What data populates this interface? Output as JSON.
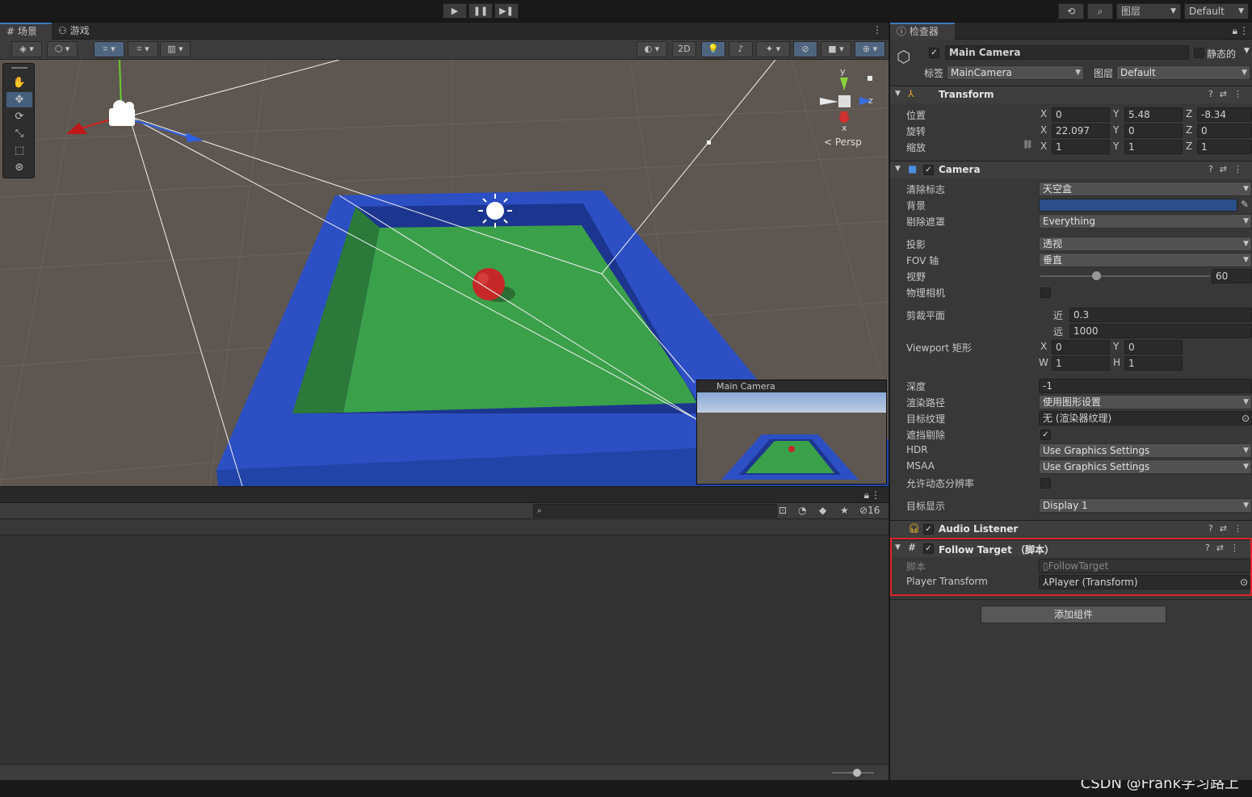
{
  "topbar": {
    "play_icon": "play-icon",
    "pause_icon": "pause-icon",
    "step_icon": "step-icon",
    "layers_label": "图层",
    "layout_label": "Default"
  },
  "scene": {
    "tab_scene": "场景",
    "tab_game": "游戏",
    "btn_2d": "2D",
    "gizmo_persp": "Persp",
    "gizmo_y": "y",
    "gizmo_z": "z",
    "gizmo_x": "x",
    "camera_preview_title": "Main Camera"
  },
  "bottom": {
    "search_placeholder": "",
    "hidden_count": "16"
  },
  "inspector": {
    "tab_title": "检查器",
    "object_name": "Main Camera",
    "object_enabled": true,
    "static_label": "静态的",
    "tag_label": "标签",
    "tag_value": "MainCamera",
    "layer_label": "图层",
    "layer_value": "Default",
    "transform": {
      "title": "Transform",
      "position_label": "位置",
      "rotation_label": "旋转",
      "scale_label": "缩放",
      "position": {
        "x": "0",
        "y": "5.48",
        "z": "-8.34"
      },
      "rotation": {
        "x": "22.097",
        "y": "0",
        "z": "0"
      },
      "scale": {
        "x": "1",
        "y": "1",
        "z": "1"
      }
    },
    "camera": {
      "title": "Camera",
      "clear_flags_label": "清除标志",
      "clear_flags_value": "天空盒",
      "background_label": "背景",
      "background_color": "#2c4f8a",
      "culling_mask_label": "剔除遮罩",
      "culling_mask_value": "Everything",
      "projection_label": "投影",
      "projection_value": "透视",
      "fov_axis_label": "FOV 轴",
      "fov_axis_value": "垂直",
      "fov_label": "视野",
      "fov_value": "60",
      "fov_fraction": 0.33,
      "physical_camera_label": "物理相机",
      "clipping_label": "剪裁平面",
      "near_label": "近",
      "near_value": "0.3",
      "far_label": "远",
      "far_value": "1000",
      "viewport_label": "Viewport 矩形",
      "vp_x": "0",
      "vp_y": "0",
      "vp_w": "1",
      "vp_h": "1",
      "depth_label": "深度",
      "depth_value": "-1",
      "rendering_path_label": "渲染路径",
      "rendering_path_value": "使用图形设置",
      "target_texture_label": "目标纹理",
      "target_texture_value": "无 (渲染器纹理)",
      "occlusion_label": "遮挡剔除",
      "hdr_label": "HDR",
      "hdr_value": "Use Graphics Settings",
      "msaa_label": "MSAA",
      "msaa_value": "Use Graphics Settings",
      "dynamic_res_label": "允许动态分辨率",
      "target_display_label": "目标显示",
      "target_display_value": "Display 1"
    },
    "audio_listener": {
      "title": "Audio Listener"
    },
    "follow_target": {
      "title": "Follow Target （脚本）",
      "script_label": "脚本",
      "script_value": "FollowTarget",
      "player_transform_label": "Player Transform",
      "player_transform_value": "Player (Transform)",
      "highlight_color": "#e0242c"
    },
    "add_component_label": "添加组件"
  },
  "watermark": "CSDN @Frank学习路上"
}
